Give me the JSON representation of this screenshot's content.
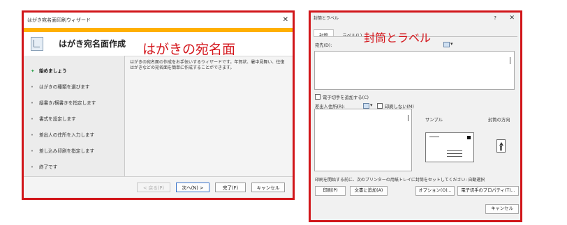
{
  "hagaki_wizard": {
    "window_title": "はがき宛名面印刷ウィザード",
    "close_glyph": "✕",
    "header_title": "はがき宛名面作成",
    "callout": "はがきの宛名面",
    "steps": [
      {
        "bullet": "✦",
        "label": "始めましょう"
      },
      {
        "bullet": "•",
        "label": "はがきの種類を選びます"
      },
      {
        "bullet": "•",
        "label": "縦書き/横書きを指定します"
      },
      {
        "bullet": "•",
        "label": "書式を設定します"
      },
      {
        "bullet": "•",
        "label": "差出人の住所を入力します"
      },
      {
        "bullet": "•",
        "label": "差し込み印刷を指定します"
      },
      {
        "bullet": "•",
        "label": "終了です"
      }
    ],
    "description": "はがきの宛名面の作成をお手伝いするウィザードです。年賀状、暑中見舞い、往復はがきなどの宛名面を簡単に作成することができます。",
    "buttons": {
      "back": "< 戻る(P)",
      "next": "次へ(N) >",
      "finish": "完了(F)",
      "cancel": "キャンセル"
    }
  },
  "envelope_dialog": {
    "window_title": "封筒とラベル",
    "help_glyph": "?",
    "close_glyph": "✕",
    "tabs": [
      "封筒",
      "ラベル(L)"
    ],
    "callout": "封筒とラベル",
    "delivery_address_label": "宛先(D):",
    "add_postage_label": "電子切手を追加する(C)",
    "return_address_label": "差出人住所(R):",
    "omit_label": "印刷しない(M)",
    "sample_label": "サンプル",
    "feed_label": "封筒の方向",
    "status_text": "印刷を開始する前に、次のプリンターの用紙トレイに封筒をセットしてください: 自動選択",
    "buttons": {
      "print": "印刷(P)",
      "add_to_document": "文書に追加(A)",
      "options": "オプション(O)...",
      "postage_properties": "電子切手のプロパティ(T)...",
      "cancel": "キャンセル"
    }
  }
}
